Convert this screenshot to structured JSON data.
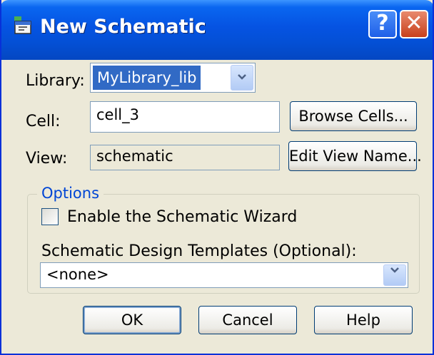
{
  "window": {
    "title": "New Schematic",
    "help_label": "?",
    "close_label": "✕",
    "icon": "schematic-app-icon"
  },
  "form": {
    "library_label": "Library:",
    "library_value": "MyLibrary_lib",
    "cell_label": "Cell:",
    "cell_value": "cell_3",
    "browse_cells_label": "Browse Cells...",
    "view_label": "View:",
    "view_value": "schematic",
    "edit_view_name_label": "Edit View Name..."
  },
  "options": {
    "group_title": "Options",
    "wizard_label": "Enable the Schematic Wizard",
    "wizard_checked": false,
    "templates_label": "Schematic Design Templates (Optional):",
    "templates_value": "<none>"
  },
  "buttons": {
    "ok": "OK",
    "cancel": "Cancel",
    "help": "Help"
  },
  "colors": {
    "title_bar": "#0553e2",
    "dialog_bg": "#ece9d8",
    "selection": "#316ac5",
    "group_title": "#0046d5"
  }
}
